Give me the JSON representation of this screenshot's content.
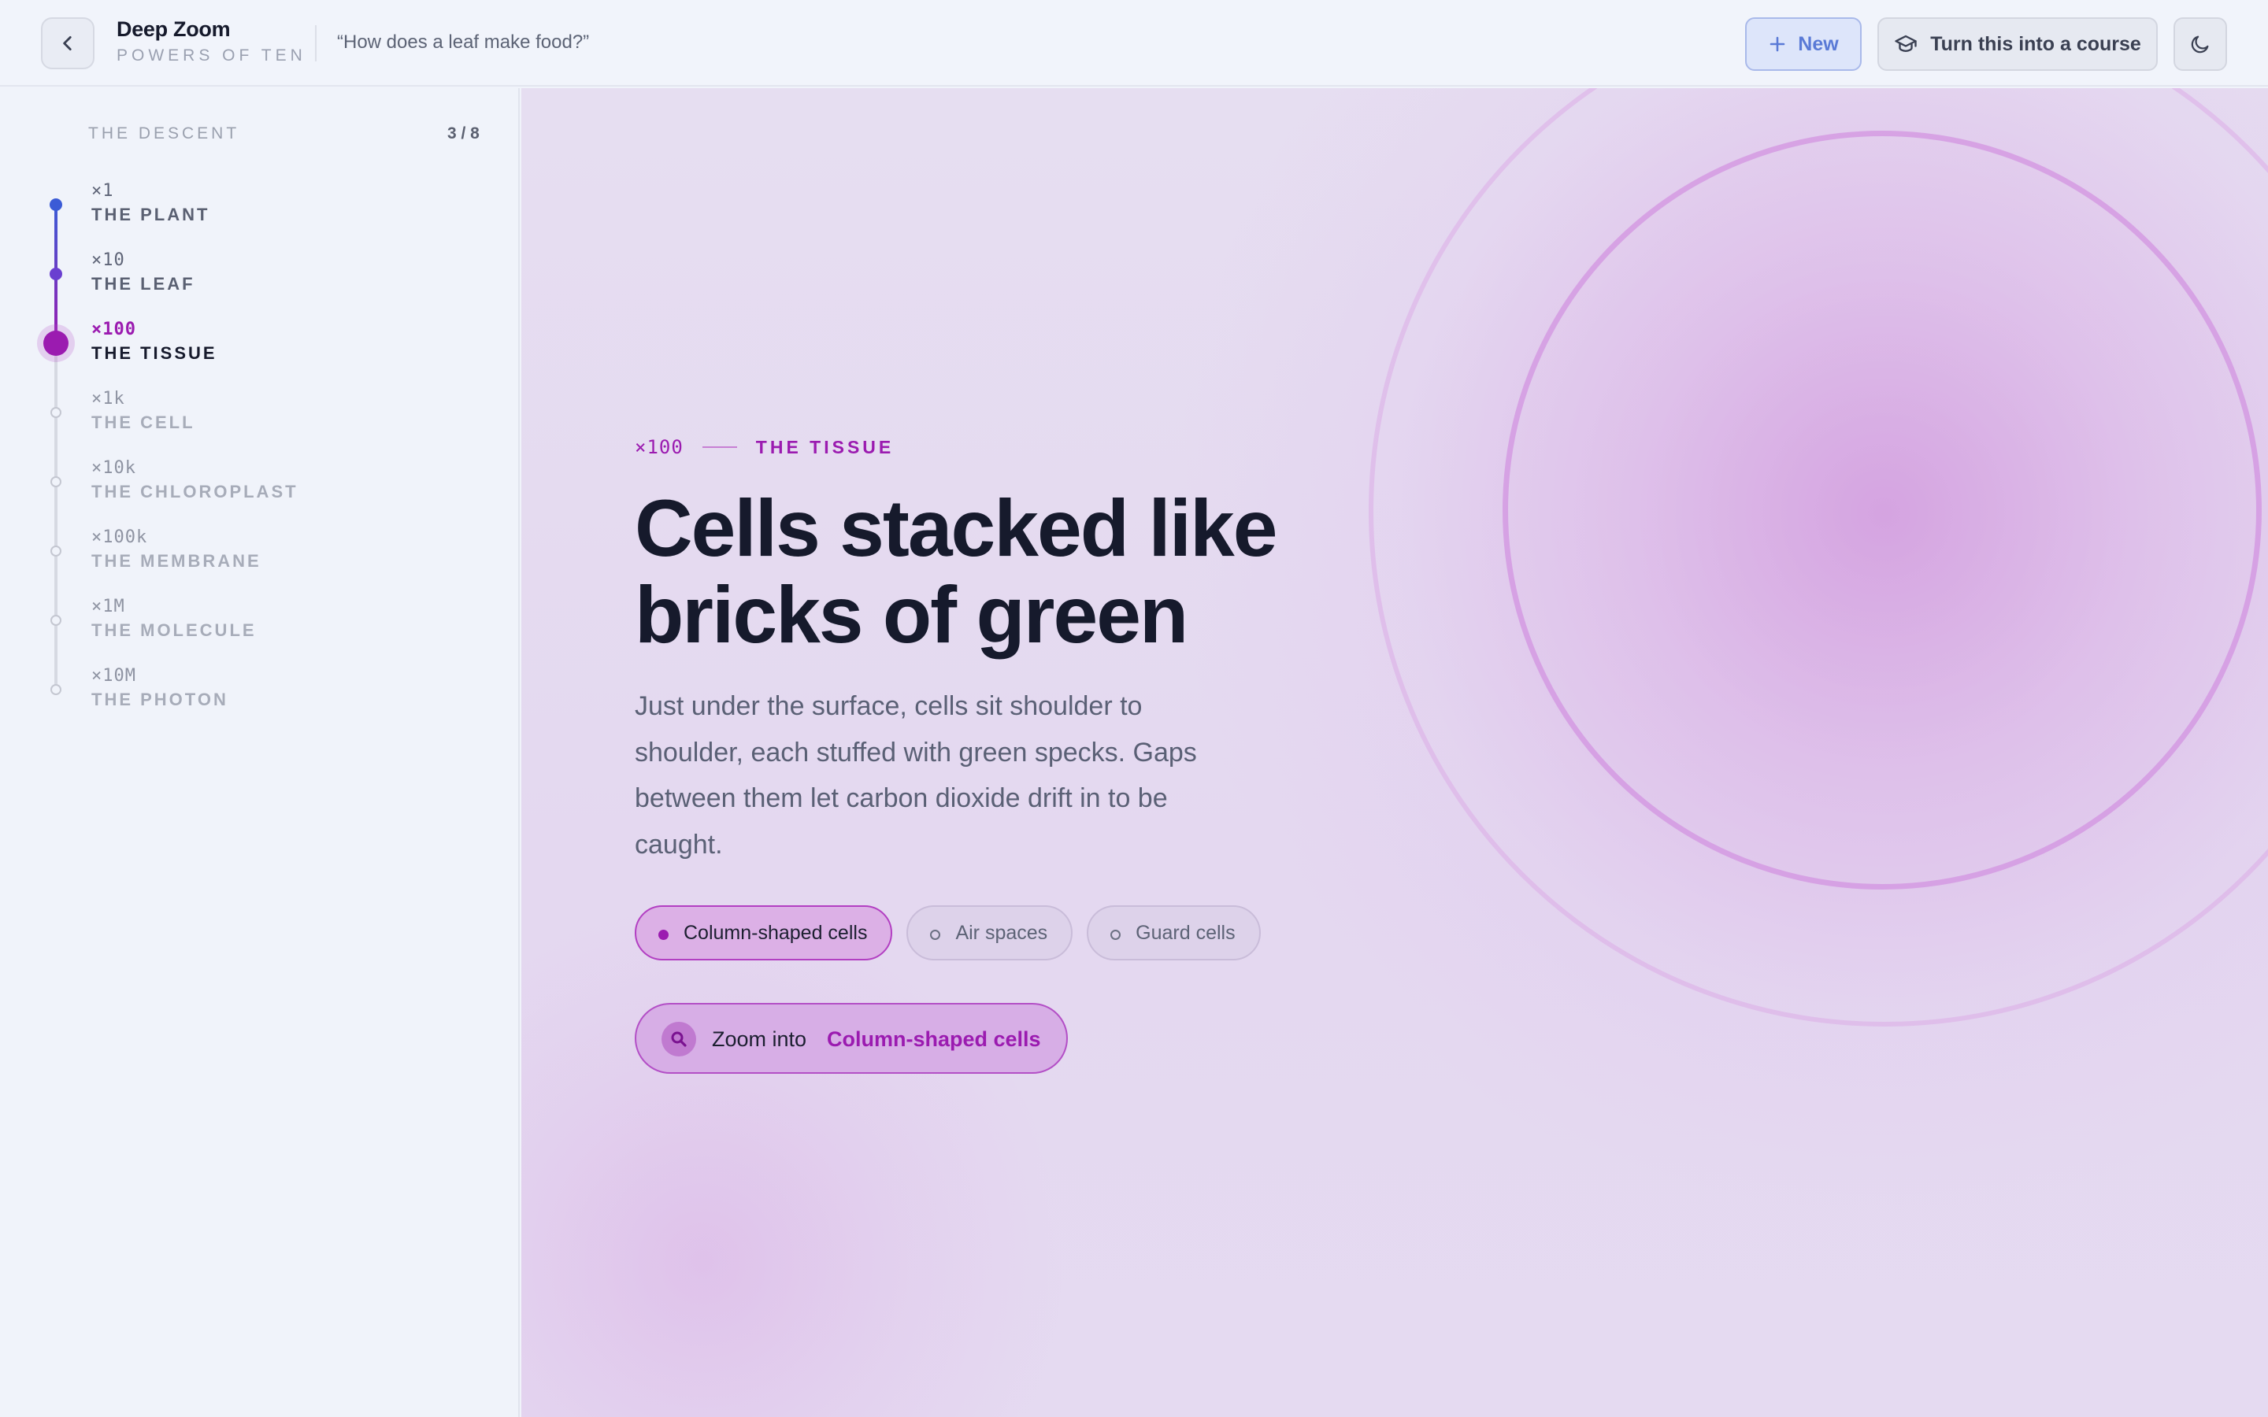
{
  "header": {
    "app_title": "Deep Zoom",
    "app_subtitle": "POWERS OF TEN",
    "question": "“How does a leaf make food?”",
    "new_label": "New",
    "course_label": "Turn this into a course"
  },
  "sidebar": {
    "section_label": "THE DESCENT",
    "progress": "3 / 8",
    "steps": [
      {
        "scale": "×1",
        "title": "THE PLANT",
        "state": "done"
      },
      {
        "scale": "×10",
        "title": "THE LEAF",
        "state": "done"
      },
      {
        "scale": "×100",
        "title": "THE TISSUE",
        "state": "current"
      },
      {
        "scale": "×1k",
        "title": "THE CELL",
        "state": "upcoming"
      },
      {
        "scale": "×10k",
        "title": "THE CHLOROPLAST",
        "state": "upcoming"
      },
      {
        "scale": "×100k",
        "title": "THE MEMBRANE",
        "state": "upcoming"
      },
      {
        "scale": "×1M",
        "title": "THE MOLECULE",
        "state": "upcoming"
      },
      {
        "scale": "×10M",
        "title": "THE PHOTON",
        "state": "upcoming"
      }
    ]
  },
  "main": {
    "eyebrow_scale": "×100",
    "eyebrow_title": "THE TISSUE",
    "headline": "Cells stacked like bricks of green",
    "body": "Just under the surface, cells sit shoulder to shoulder, each stuffed with green specks. Gaps between them let carbon dioxide drift in to be caught.",
    "chips": [
      {
        "label": "Column-shaped cells",
        "selected": true
      },
      {
        "label": "Air spaces",
        "selected": false
      },
      {
        "label": "Guard cells",
        "selected": false
      }
    ],
    "zoom_prefix": "Zoom into",
    "zoom_target": "Column-shaped cells"
  },
  "colors": {
    "accent": "#9b1bb0",
    "done_start": "#3b5bd6",
    "done_end": "#8a2bc4",
    "upcoming": "#c4c7d1",
    "background": "#f0f3fa"
  },
  "icons": {
    "back": "chevron-left-icon",
    "new": "plus-icon",
    "course": "graduation-cap-icon",
    "theme": "moon-icon",
    "zoom": "search-icon"
  }
}
